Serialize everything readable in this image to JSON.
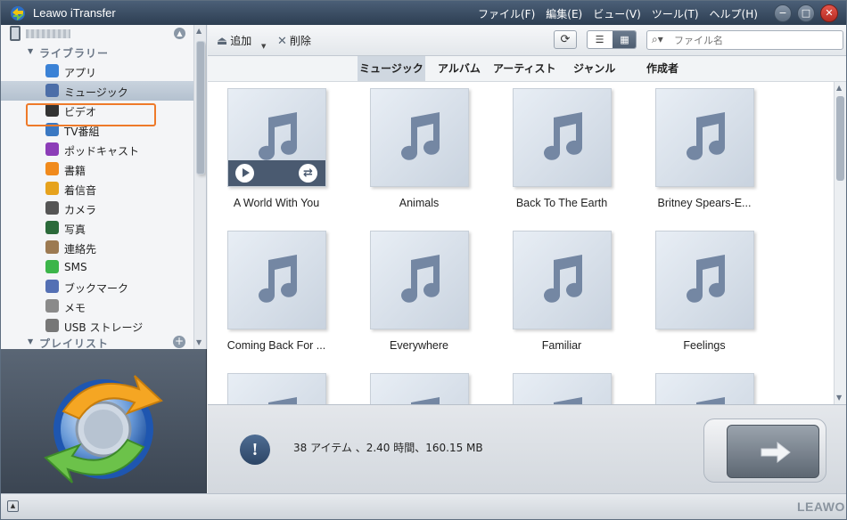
{
  "window": {
    "title": "Leawo iTransfer",
    "menu": [
      "ファイル(F)",
      "編集(E)",
      "ビュー(V)",
      "ツール(T)",
      "ヘルプ(H)"
    ],
    "controls": {
      "minimize": "−",
      "maximize": "□",
      "close": "✕"
    }
  },
  "sidebar": {
    "library_label": "ライブラリー",
    "items": [
      {
        "label": "アプリ",
        "icon": "app-store-icon",
        "color": "#3b82d6"
      },
      {
        "label": "ミュージック",
        "icon": "music-note-icon",
        "color": "#4c6ea8",
        "selected": true
      },
      {
        "label": "ビデオ",
        "icon": "film-icon",
        "color": "#333333"
      },
      {
        "label": "TV番組",
        "icon": "tv-icon",
        "color": "#3a78c2"
      },
      {
        "label": "ポッドキャスト",
        "icon": "podcast-icon",
        "color": "#8c3db8"
      },
      {
        "label": "書籍",
        "icon": "book-icon",
        "color": "#f08a1c"
      },
      {
        "label": "着信音",
        "icon": "bell-icon",
        "color": "#e6a21d"
      },
      {
        "label": "カメラ",
        "icon": "camera-icon",
        "color": "#555555"
      },
      {
        "label": "写真",
        "icon": "photo-icon",
        "color": "#2b6a3a"
      },
      {
        "label": "連絡先",
        "icon": "contacts-icon",
        "color": "#9c7a52"
      },
      {
        "label": "SMS",
        "icon": "sms-icon",
        "color": "#3cb54a"
      },
      {
        "label": "ブックマーク",
        "icon": "bookmark-icon",
        "color": "#5470b4"
      },
      {
        "label": "メモ",
        "icon": "memo-icon",
        "color": "#8a8a8a"
      },
      {
        "label": "USB ストレージ",
        "icon": "usb-icon",
        "color": "#777777"
      }
    ],
    "playlist_label": "プレイリスト"
  },
  "toolbar": {
    "add_label": "追加",
    "delete_label": "削除",
    "refresh_icon": "⟳",
    "search_placeholder": "ファイル名"
  },
  "tabs": [
    {
      "label": "ミュージック",
      "active": true
    },
    {
      "label": "アルバム",
      "active": false
    },
    {
      "label": "アーティスト",
      "active": false
    },
    {
      "label": "ジャンル",
      "active": false
    },
    {
      "label": "作成者",
      "active": false
    }
  ],
  "songs": [
    {
      "title": "A World With You",
      "hover": true
    },
    {
      "title": "Animals"
    },
    {
      "title": "Back To The Earth"
    },
    {
      "title": "Britney Spears-E..."
    },
    {
      "title": "Coming Back For ..."
    },
    {
      "title": "Everywhere"
    },
    {
      "title": "Familiar"
    },
    {
      "title": "Feelings"
    }
  ],
  "status": {
    "text": "38 アイテム 、2.40 時間、160.15 MB"
  },
  "brand": "LEAWO",
  "colors": {
    "accent_orange": "#ee7a2a",
    "title_bar": "#2d3e52"
  }
}
